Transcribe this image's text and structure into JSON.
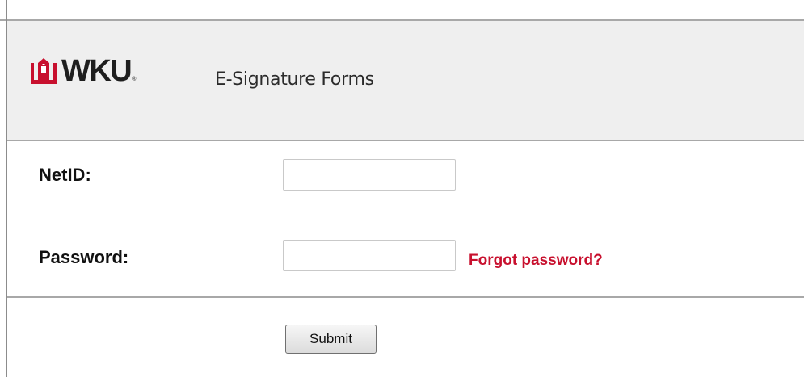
{
  "header": {
    "logo_text": "WKU",
    "logo_trademark": "®",
    "title": "E-Signature Forms"
  },
  "form": {
    "netid_label": "NetID:",
    "netid_value": "",
    "password_label": "Password:",
    "password_value": "",
    "forgot_password_link": "Forgot password?",
    "submit_label": "Submit"
  },
  "colors": {
    "brand_red": "#c8102e",
    "header_background": "#efefef",
    "border_gray": "#a8a8a8"
  },
  "icons": {
    "logo_mark": "wku-tower-icon"
  }
}
